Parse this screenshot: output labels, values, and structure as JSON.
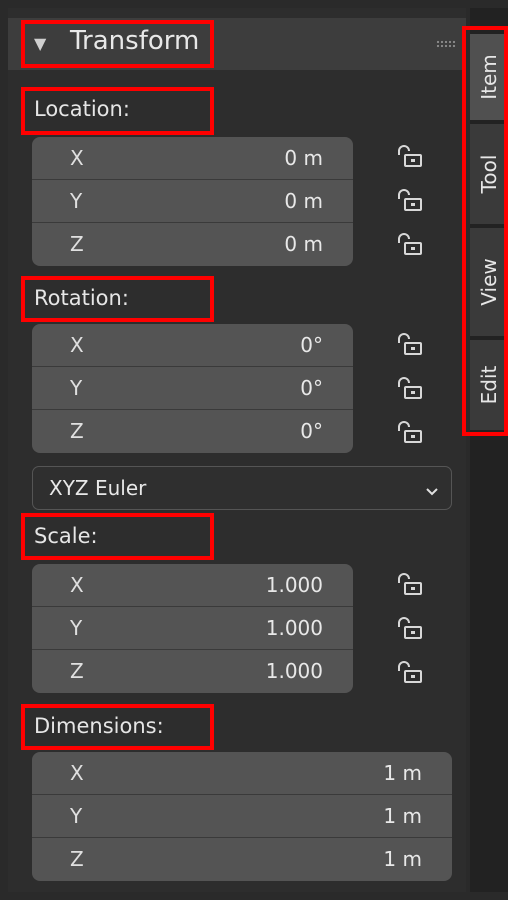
{
  "header": {
    "title": "Transform"
  },
  "tabs": [
    {
      "label": "Item",
      "active": true
    },
    {
      "label": "Tool",
      "active": false
    },
    {
      "label": "View",
      "active": false
    },
    {
      "label": "Edit",
      "active": false
    }
  ],
  "location": {
    "label": "Location:",
    "rows": [
      {
        "axis": "X",
        "value": "0 m"
      },
      {
        "axis": "Y",
        "value": "0 m"
      },
      {
        "axis": "Z",
        "value": "0 m"
      }
    ]
  },
  "rotation": {
    "label": "Rotation:",
    "rows": [
      {
        "axis": "X",
        "value": "0°"
      },
      {
        "axis": "Y",
        "value": "0°"
      },
      {
        "axis": "Z",
        "value": "0°"
      }
    ],
    "mode": {
      "selected": "XYZ Euler"
    }
  },
  "scale": {
    "label": "Scale:",
    "rows": [
      {
        "axis": "X",
        "value": "1.000"
      },
      {
        "axis": "Y",
        "value": "1.000"
      },
      {
        "axis": "Z",
        "value": "1.000"
      }
    ]
  },
  "dimensions": {
    "label": "Dimensions:",
    "rows": [
      {
        "axis": "X",
        "value": "1 m"
      },
      {
        "axis": "Y",
        "value": "1 m"
      },
      {
        "axis": "Z",
        "value": "1 m"
      }
    ]
  },
  "icons": {
    "collapse": "triangle-down-icon",
    "grip": "drag-grip-icon",
    "lock": "lock-open-icon",
    "dropdown": "chevron-down-icon"
  },
  "colors": {
    "highlight": "#ff0000",
    "panel_bg": "#2d2d2d",
    "field_bg": "#545454"
  }
}
